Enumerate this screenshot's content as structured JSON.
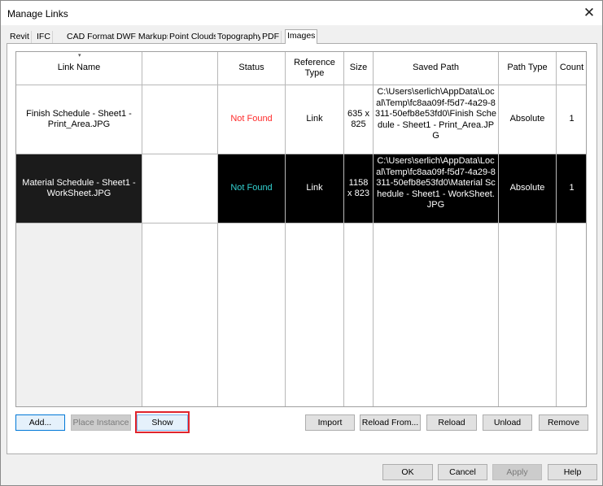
{
  "window": {
    "title": "Manage Links",
    "close_glyph": "✕"
  },
  "tabs": [
    {
      "label": "Revit"
    },
    {
      "label": "IFC"
    },
    {
      "label": "CAD Formats"
    },
    {
      "label": "DWF Markups"
    },
    {
      "label": "Point Clouds"
    },
    {
      "label": "Topography"
    },
    {
      "label": "PDF"
    },
    {
      "label": "Images",
      "active": true
    }
  ],
  "table": {
    "sort_indicator": "▾",
    "headers": {
      "link_name": "Link Name",
      "blank": "",
      "status": "Status",
      "reference_type": "Reference Type",
      "size": "Size",
      "saved_path": "Saved Path",
      "path_type": "Path Type",
      "count": "Count"
    },
    "rows": [
      {
        "link_name": "Finish Schedule - Sheet1 - Print_Area.JPG",
        "blank": "",
        "status": "Not Found",
        "reference_type": "Link",
        "size": "635 x 825",
        "saved_path": "C:\\Users\\serlich\\AppData\\Local\\Temp\\fc8aa09f-f5d7-4a29-8311-50efb8e53fd0\\Finish Schedule - Sheet1 - Print_Area.JPG",
        "path_type": "Absolute",
        "count": "1",
        "selected": false
      },
      {
        "link_name": "Material Schedule - Sheet1 - WorkSheet.JPG",
        "blank": "",
        "status": "Not Found",
        "reference_type": "Link",
        "size": "1158 x 823",
        "saved_path": "C:\\Users\\serlich\\AppData\\Local\\Temp\\fc8aa09f-f5d7-4a29-8311-50efb8e53fd0\\Material Schedule - Sheet1 - WorkSheet.JPG",
        "path_type": "Absolute",
        "count": "1",
        "selected": true
      }
    ]
  },
  "buttons": {
    "add": "Add...",
    "place_instance": "Place Instance",
    "show": "Show",
    "import": "Import",
    "reload_from": "Reload From...",
    "reload": "Reload",
    "unload": "Unload",
    "remove": "Remove",
    "ok": "OK",
    "cancel": "Cancel",
    "apply": "Apply",
    "help": "Help"
  },
  "colors": {
    "status_not_found": "#ff2b2b",
    "status_not_found_selected": "#33d1d1",
    "selection_bg": "#000000",
    "highlight_box": "#e0242c",
    "focus_border": "#0078d7"
  }
}
